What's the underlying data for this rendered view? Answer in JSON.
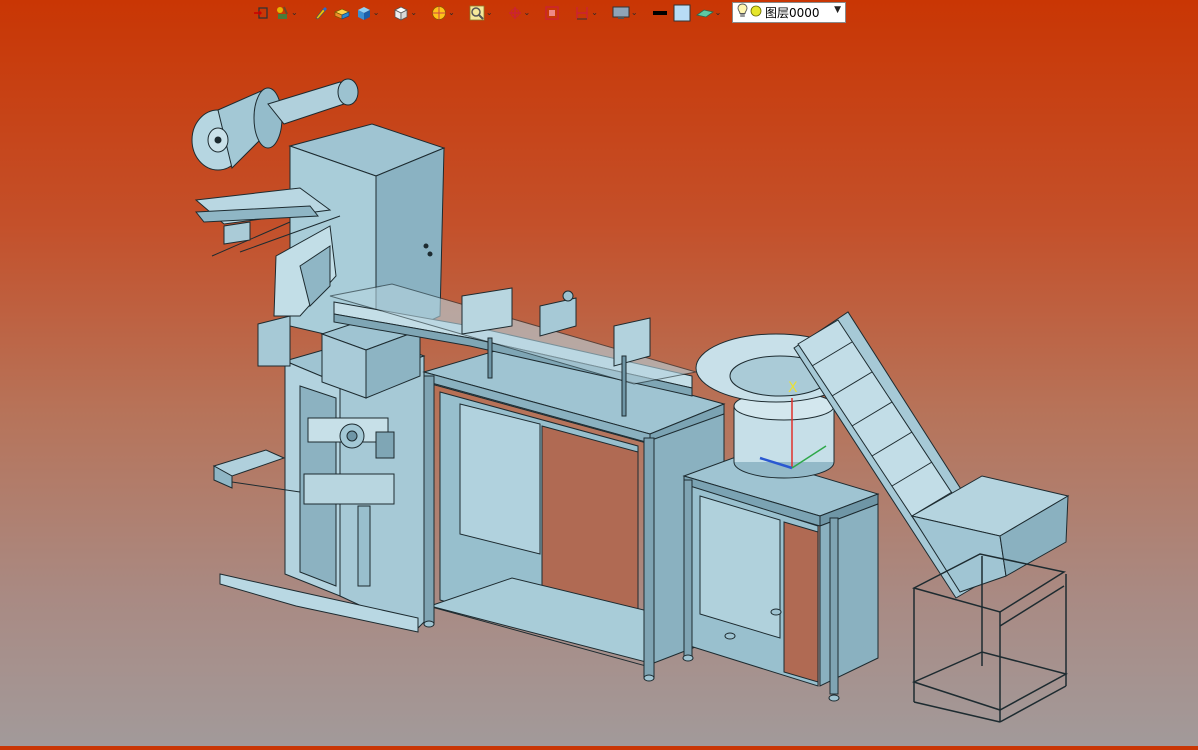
{
  "toolbar": {
    "tools": [
      {
        "id": "snap",
        "icon": "snap-point-icon",
        "has_dropdown": false
      },
      {
        "id": "material",
        "icon": "material-brush-icon",
        "has_dropdown": true
      },
      {
        "id": "pen",
        "icon": "pen-icon",
        "has_dropdown": false
      },
      {
        "id": "color",
        "icon": "color-box-icon",
        "has_dropdown": false
      },
      {
        "id": "render",
        "icon": "render-cube-icon",
        "has_dropdown": true
      },
      {
        "id": "view",
        "icon": "view-cube-icon",
        "has_dropdown": true
      },
      {
        "id": "section",
        "icon": "section-disc-icon",
        "has_dropdown": true
      },
      {
        "id": "zoom",
        "icon": "zoom-magnifier-icon",
        "has_dropdown": true
      },
      {
        "id": "rotate",
        "icon": "rotate-axis-icon",
        "has_dropdown": true
      },
      {
        "id": "fit",
        "icon": "fit-frame-icon",
        "has_dropdown": false
      },
      {
        "id": "measure",
        "icon": "measure-ruler-icon",
        "has_dropdown": true
      },
      {
        "id": "display",
        "icon": "display-monitor-icon",
        "has_dropdown": true
      },
      {
        "id": "line",
        "icon": "line-color-icon",
        "has_dropdown": false
      },
      {
        "id": "fill",
        "icon": "fill-color-icon",
        "has_dropdown": false
      },
      {
        "id": "layer-tool",
        "icon": "layer-plane-icon",
        "has_dropdown": true
      }
    ],
    "layer": {
      "name": "图层0000",
      "icon": "lightbulb-icon",
      "state_icon": "layer-status-dot-icon"
    }
  },
  "colors": {
    "bg_top": "#c93604",
    "bg_bottom": "#a29a9a",
    "model_face": "#9fc4d2",
    "model_edge": "#1d2b30"
  }
}
